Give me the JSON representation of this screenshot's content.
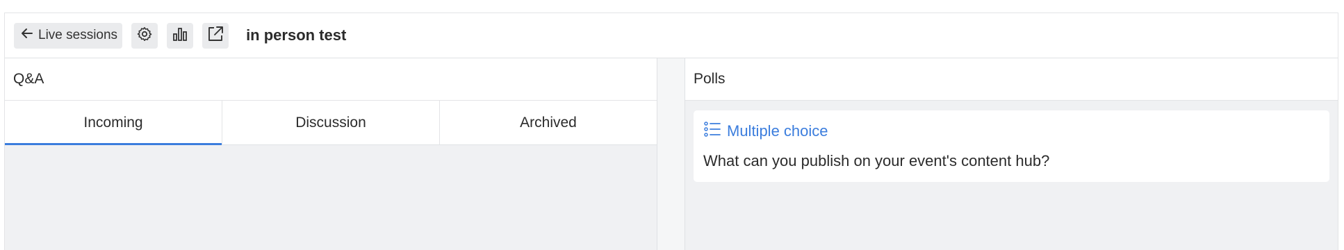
{
  "header": {
    "back_label": "Live sessions",
    "session_title": "in person test",
    "icons": [
      "arrow-left-icon",
      "gear-icon",
      "bar-chart-icon",
      "external-link-icon"
    ]
  },
  "qa": {
    "title": "Q&A",
    "tabs": [
      {
        "label": "Incoming",
        "active": true
      },
      {
        "label": "Discussion",
        "active": false
      },
      {
        "label": "Archived",
        "active": false
      }
    ]
  },
  "polls": {
    "title": "Polls",
    "items": [
      {
        "type_label": "Multiple choice",
        "question": "What can you publish on your event's content hub?",
        "icon": "list-icon"
      }
    ]
  },
  "colors": {
    "accent": "#3b7ddd",
    "button_bg": "#eaebed",
    "panel_bg": "#f0f1f3"
  }
}
